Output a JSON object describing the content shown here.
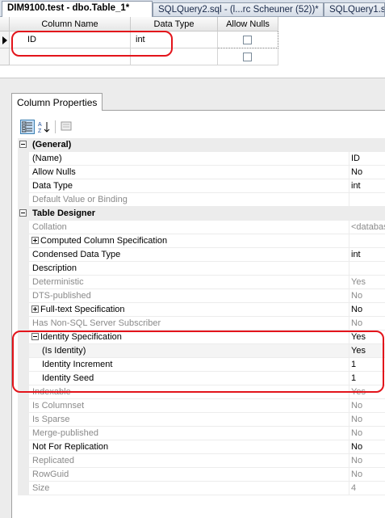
{
  "tabs": [
    {
      "label": "DIM9100.test - dbo.Table_1*",
      "active": true
    },
    {
      "label": "SQLQuery2.sql - (l...rc Scheuner (52))*",
      "active": false
    },
    {
      "label": "SQLQuery1.s",
      "active": false
    }
  ],
  "grid": {
    "headers": {
      "column_name": "Column Name",
      "data_type": "Data Type",
      "allow_nulls": "Allow Nulls"
    },
    "rows": [
      {
        "column_name": "ID",
        "data_type": "int",
        "allow_nulls": false
      },
      {
        "column_name": "",
        "data_type": "",
        "allow_nulls": false
      }
    ]
  },
  "column_properties": {
    "tab_label": "Column Properties",
    "toolbar": {
      "categorized": "categorized-icon",
      "alphabetical": "alphabetical-icon",
      "property_pages": "property-pages-icon"
    },
    "rows": [
      {
        "type": "category",
        "name": "(General)"
      },
      {
        "type": "prop",
        "name": "(Name)",
        "value": "ID"
      },
      {
        "type": "prop",
        "name": "Allow Nulls",
        "value": "No"
      },
      {
        "type": "prop",
        "name": "Data Type",
        "value": "int"
      },
      {
        "type": "prop",
        "name": "Default Value or Binding",
        "value": "",
        "dim": true
      },
      {
        "type": "category",
        "name": "Table Designer"
      },
      {
        "type": "prop",
        "name": "Collation",
        "value": "<database default>",
        "dim": true
      },
      {
        "type": "prop",
        "name": "Computed Column Specification",
        "value": "",
        "expand": "plus"
      },
      {
        "type": "prop",
        "name": "Condensed Data Type",
        "value": "int"
      },
      {
        "type": "prop",
        "name": "Description",
        "value": ""
      },
      {
        "type": "prop",
        "name": "Deterministic",
        "value": "Yes",
        "dim": true
      },
      {
        "type": "prop",
        "name": "DTS-published",
        "value": "No",
        "dim": true
      },
      {
        "type": "prop",
        "name": "Full-text Specification",
        "value": "No",
        "expand": "plus"
      },
      {
        "type": "prop",
        "name": "Has Non-SQL Server Subscriber",
        "value": "No",
        "dim": true
      },
      {
        "type": "prop",
        "name": "Identity Specification",
        "value": "Yes",
        "expand": "minus"
      },
      {
        "type": "prop",
        "name": "(Is Identity)",
        "value": "Yes",
        "indent": true,
        "highlight": true
      },
      {
        "type": "prop",
        "name": "Identity Increment",
        "value": "1",
        "indent": true
      },
      {
        "type": "prop",
        "name": "Identity Seed",
        "value": "1",
        "indent": true
      },
      {
        "type": "prop",
        "name": "Indexable",
        "value": "Yes",
        "dim": true
      },
      {
        "type": "prop",
        "name": "Is Columnset",
        "value": "No",
        "dim": true
      },
      {
        "type": "prop",
        "name": "Is Sparse",
        "value": "No",
        "dim": true
      },
      {
        "type": "prop",
        "name": "Merge-published",
        "value": "No",
        "dim": true
      },
      {
        "type": "prop",
        "name": "Not For Replication",
        "value": "No"
      },
      {
        "type": "prop",
        "name": "Replicated",
        "value": "No",
        "dim": true
      },
      {
        "type": "prop",
        "name": "RowGuid",
        "value": "No",
        "dim": true
      },
      {
        "type": "prop",
        "name": "Size",
        "value": "4",
        "dim": true
      }
    ]
  },
  "colors": {
    "highlight_box": "#e3141b",
    "tab_active_bg": "#ffffff"
  }
}
